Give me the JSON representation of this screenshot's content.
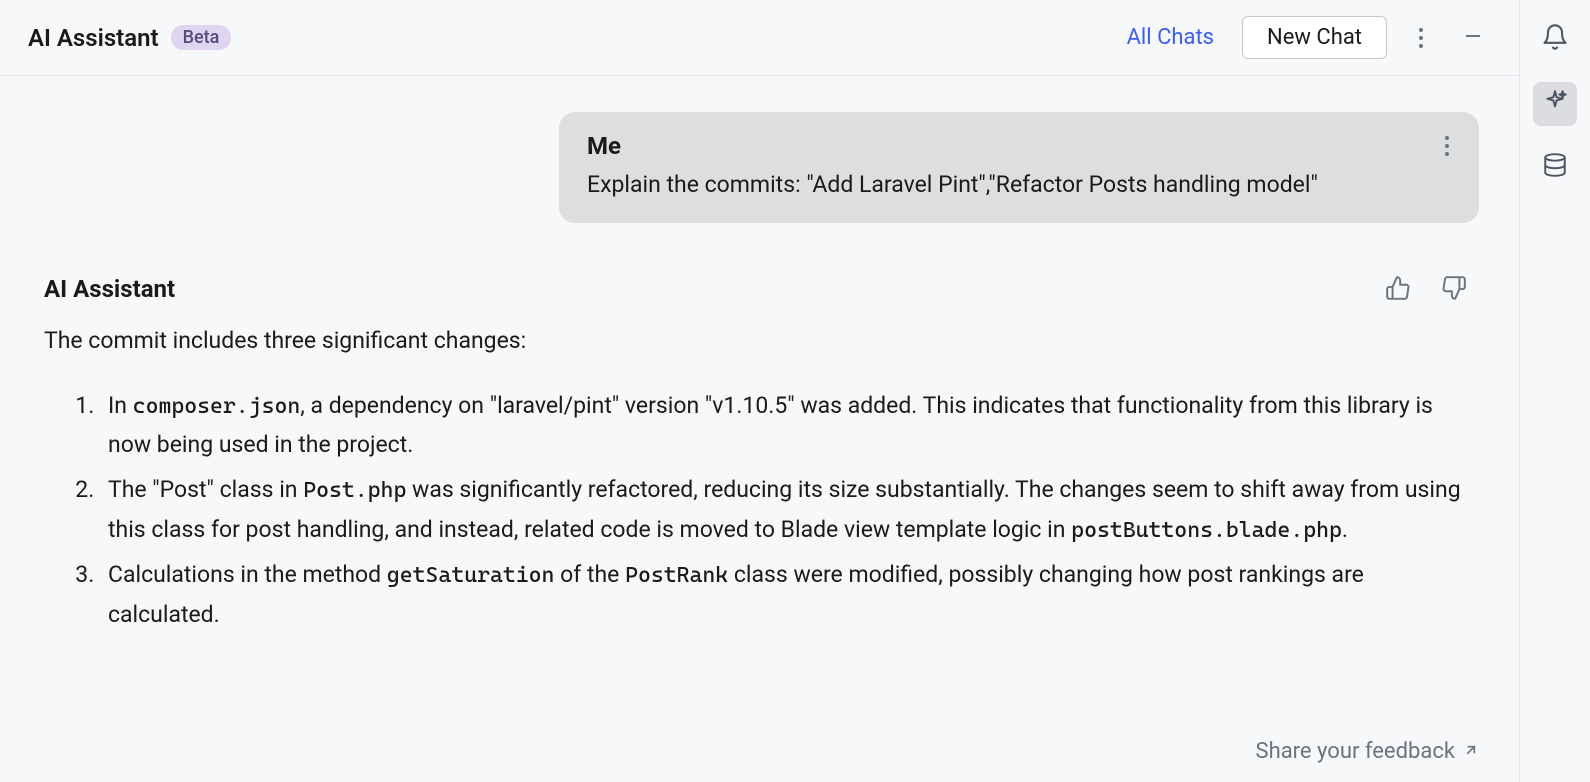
{
  "header": {
    "title": "AI Assistant",
    "badge": "Beta",
    "all_chats_label": "All Chats",
    "new_chat_label": "New Chat"
  },
  "user_message": {
    "author": "Me",
    "text": "Explain the commits: \"Add Laravel Pint\",\"Refactor Posts handling model\""
  },
  "assistant_message": {
    "author": "AI Assistant",
    "intro": "The commit includes three significant changes:",
    "items": {
      "0": {
        "pre1": "In ",
        "code1": "composer.json",
        "post1": ", a dependency on \"laravel/pint\" version \"v1.10.5\" was added. This indicates that functionality from this library is now being used in the project."
      },
      "1": {
        "pre1": "The \"Post\" class in ",
        "code1": "Post.php",
        "mid1": " was significantly refactored, reducing its size substantially. The changes seem to shift away from using this class for post handling, and instead, related code is moved to Blade view template logic in ",
        "code2": "postButtons.blade.php",
        "post1": "."
      },
      "2": {
        "pre1": "Calculations in the method ",
        "code1": "getSaturation",
        "mid1": " of the ",
        "code2": "PostRank",
        "post1": " class were modified, possibly changing how post rankings are calculated."
      }
    }
  },
  "feedback": {
    "label": "Share your feedback"
  }
}
